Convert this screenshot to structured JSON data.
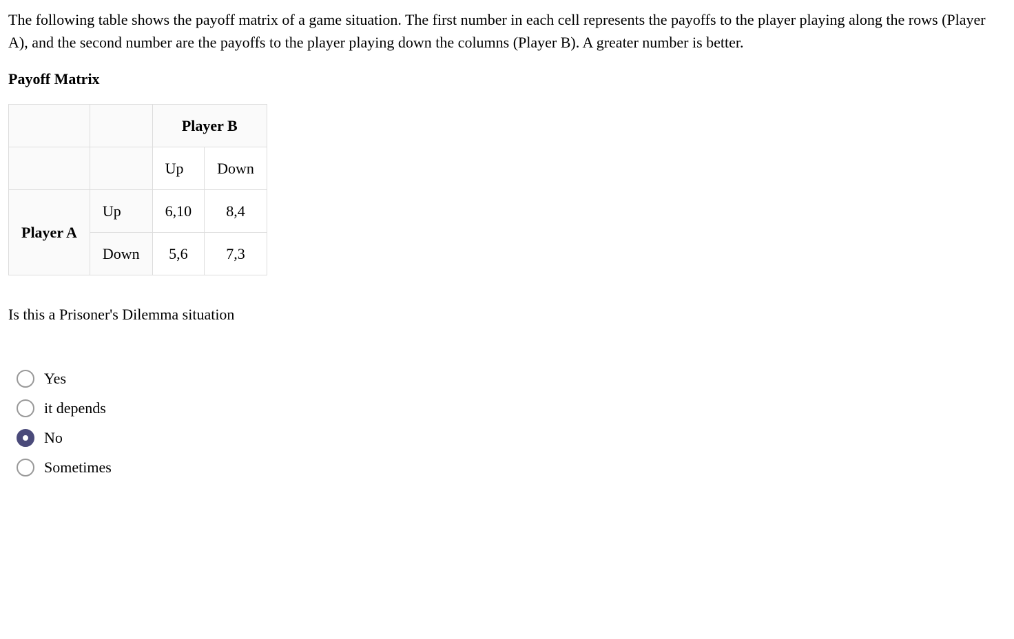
{
  "intro": "The following table shows the payoff matrix of a game situation. The first number in each cell represents the payoffs to the player playing along the rows (Player A), and the second number are the payoffs to the player playing down the columns (Player B). A greater number is better.",
  "matrix_title": "Payoff Matrix",
  "table": {
    "player_b_label": "Player B",
    "player_a_label": "Player A",
    "col_headers": [
      "Up",
      "Down"
    ],
    "row_headers": [
      "Up",
      "Down"
    ],
    "cells": [
      [
        "6,10",
        "8,4"
      ],
      [
        "5,6",
        "7,3"
      ]
    ]
  },
  "question": "Is this a Prisoner's Dilemma situation",
  "options": [
    {
      "label": "Yes",
      "selected": false
    },
    {
      "label": "it depends",
      "selected": false
    },
    {
      "label": "No",
      "selected": true
    },
    {
      "label": "Sometimes",
      "selected": false
    }
  ]
}
